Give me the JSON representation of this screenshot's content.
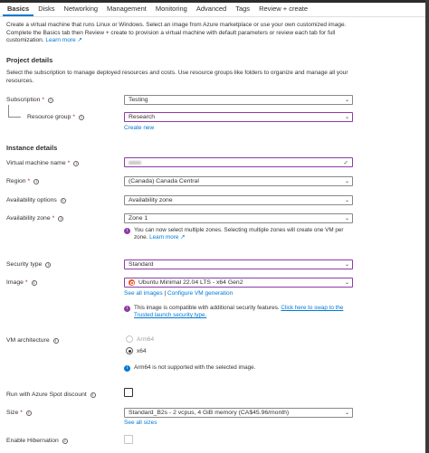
{
  "tabs": [
    {
      "label": "Basics",
      "active": true
    },
    {
      "label": "Disks"
    },
    {
      "label": "Networking"
    },
    {
      "label": "Management"
    },
    {
      "label": "Monitoring"
    },
    {
      "label": "Advanced"
    },
    {
      "label": "Tags"
    },
    {
      "label": "Review + create"
    }
  ],
  "intro": {
    "text": "Create a virtual machine that runs Linux or Windows. Select an image from Azure marketplace or use your own customized image. Complete the Basics tab then Review + create to provision a virtual machine with default parameters or review each tab for full customization. ",
    "link": "Learn more ↗"
  },
  "project": {
    "title": "Project details",
    "desc": "Select the subscription to manage deployed resources and costs. Use resource groups like folders to organize and manage all your resources.",
    "subscription_label": "Subscription",
    "subscription_value": "Testing",
    "rg_label": "Resource group",
    "rg_value": "Research",
    "create_new": "Create new"
  },
  "instance": {
    "title": "Instance details",
    "vm_name_label": "Virtual machine name",
    "region_label": "Region",
    "region_value": "(Canada) Canada Central",
    "availability_options_label": "Availability options",
    "availability_options_value": "Availability zone",
    "availability_zone_label": "Availability zone",
    "availability_zone_value": "Zone 1",
    "zone_note": "You can now select multiple zones. Selecting multiple zones will create one VM per zone. ",
    "zone_note_link": "Learn more ↗",
    "security_type_label": "Security type",
    "security_type_value": "Standard",
    "image_label": "Image",
    "image_value": "Ubuntu Minimal 22.04 LTS - x64 Gen2",
    "see_all_images": "See all images",
    "separator": " | ",
    "configure_vm": "Configure VM generation",
    "image_note": "This image is compatible with additional security features. ",
    "image_note_link": "Click here to swap to the Trusted launch security type.",
    "vm_arch_label": "VM architecture",
    "arch_arm": "Arm64",
    "arch_x64": "x64",
    "arch_note": "Arm64 is not supported with the selected image.",
    "spot_label": "Run with Azure Spot discount",
    "size_label": "Size",
    "size_value": "Standard_B2s - 2 vcpus, 4 GiB memory (CA$45.96/month)",
    "see_all_sizes": "See all sizes",
    "hibernation_label": "Enable Hibernation"
  },
  "req_mark": "*",
  "info_glyph": "i",
  "chev_glyph": "⌄",
  "check_glyph": "✓",
  "accent": "#0078d4",
  "purple_accent": "#8e3aa6"
}
